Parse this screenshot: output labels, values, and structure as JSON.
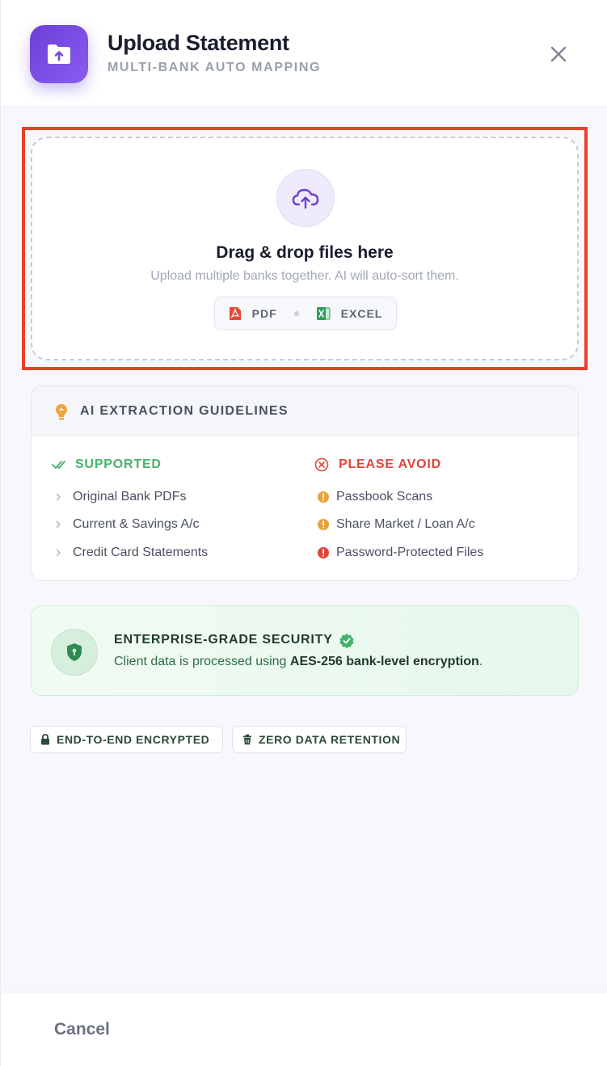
{
  "header": {
    "title": "Upload Statement",
    "subtitle": "MULTI-BANK AUTO MAPPING",
    "app_icon": "folder-upload-icon",
    "close_icon": "close-icon"
  },
  "dropzone": {
    "title": "Drag & drop files here",
    "subtitle": "Upload multiple banks together. AI will auto-sort them.",
    "file_types": [
      {
        "label": "PDF",
        "icon": "pdf-icon"
      },
      {
        "label": "EXCEL",
        "icon": "excel-icon"
      }
    ]
  },
  "guidelines": {
    "title": "AI EXTRACTION GUIDELINES",
    "supported": {
      "heading": "SUPPORTED",
      "items": [
        "Original Bank PDFs",
        "Current & Savings A/c",
        "Credit Card Statements"
      ]
    },
    "avoid": {
      "heading": "PLEASE AVOID",
      "items": [
        "Passbook Scans",
        "Share Market / Loan A/c",
        "Password-Protected Files"
      ]
    }
  },
  "security": {
    "title": "ENTERPRISE-GRADE SECURITY",
    "text_prefix": "Client data is processed using ",
    "text_bold": "AES-256 bank-level encryption",
    "text_suffix": "."
  },
  "badges": [
    "END-TO-END ENCRYPTED",
    "ZERO DATA RETENTION"
  ],
  "footer": {
    "cancel_label": "Cancel"
  },
  "colors": {
    "accent": "#7047e0",
    "highlight": "#e8402a",
    "supported": "#45b36b",
    "avoid": "#e0443a",
    "warning": "#e9a23b"
  }
}
